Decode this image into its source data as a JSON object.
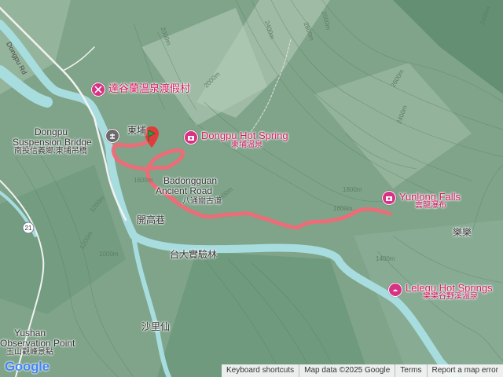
{
  "map": {
    "labels": {
      "hot_spring_resort_cn": "達谷蘭溫泉渡假村",
      "dongpu_village_cn": "東埔",
      "suspension_bridge_en_1": "Dongpu",
      "suspension_bridge_en_2": "Suspension Bridge",
      "suspension_bridge_cn": "南投信義鄉:東埔吊橋",
      "dongpu_hot_spring_en": "Dongpu Hot Spring",
      "dongpu_hot_spring_cn": "東埔溫泉",
      "badongguan_en_1": "Badongguan",
      "badongguan_en_2": "Ancient Road",
      "badongguan_cn": "八通關古道",
      "kaigao_lane_cn": "開高巷",
      "yunlong_falls_en": "Yunlong Falls",
      "yunlong_falls_cn": "雲龍瀑布",
      "lele_cn": "樂樂",
      "ntu_forest_cn": "台大實驗林",
      "lelegu_en": "Lelegu Hot Springs",
      "lelegu_cn": "樂樂谷野溪溫泉",
      "shalixian_cn": "沙里仙",
      "yushan_obs_en_1": "Yushan",
      "yushan_obs_en_2": "Observation Point",
      "yushan_obs_cn": "玉山觀峰景點",
      "dongpu_rd": "Dongpu Rd",
      "route_21": "21"
    },
    "contours": [
      "2400m",
      "2000m",
      "2600m",
      "2400m",
      "2800m",
      "2000m",
      "2400m",
      "1800m",
      "1600m",
      "1200m",
      "1200m",
      "1000m",
      "1800m",
      "2000m",
      "1600m",
      "1400m"
    ],
    "colors": {
      "track": "#f06a77",
      "river": "#a8dde0",
      "poi_pink": "#d63384",
      "start_green": "#2ea043",
      "terrain": "#7fa48a"
    }
  },
  "attribution": {
    "logo": "Google",
    "keyboard_shortcuts": "Keyboard shortcuts",
    "map_data": "Map data ©2025 Google",
    "terms": "Terms",
    "report": "Report a map error"
  }
}
